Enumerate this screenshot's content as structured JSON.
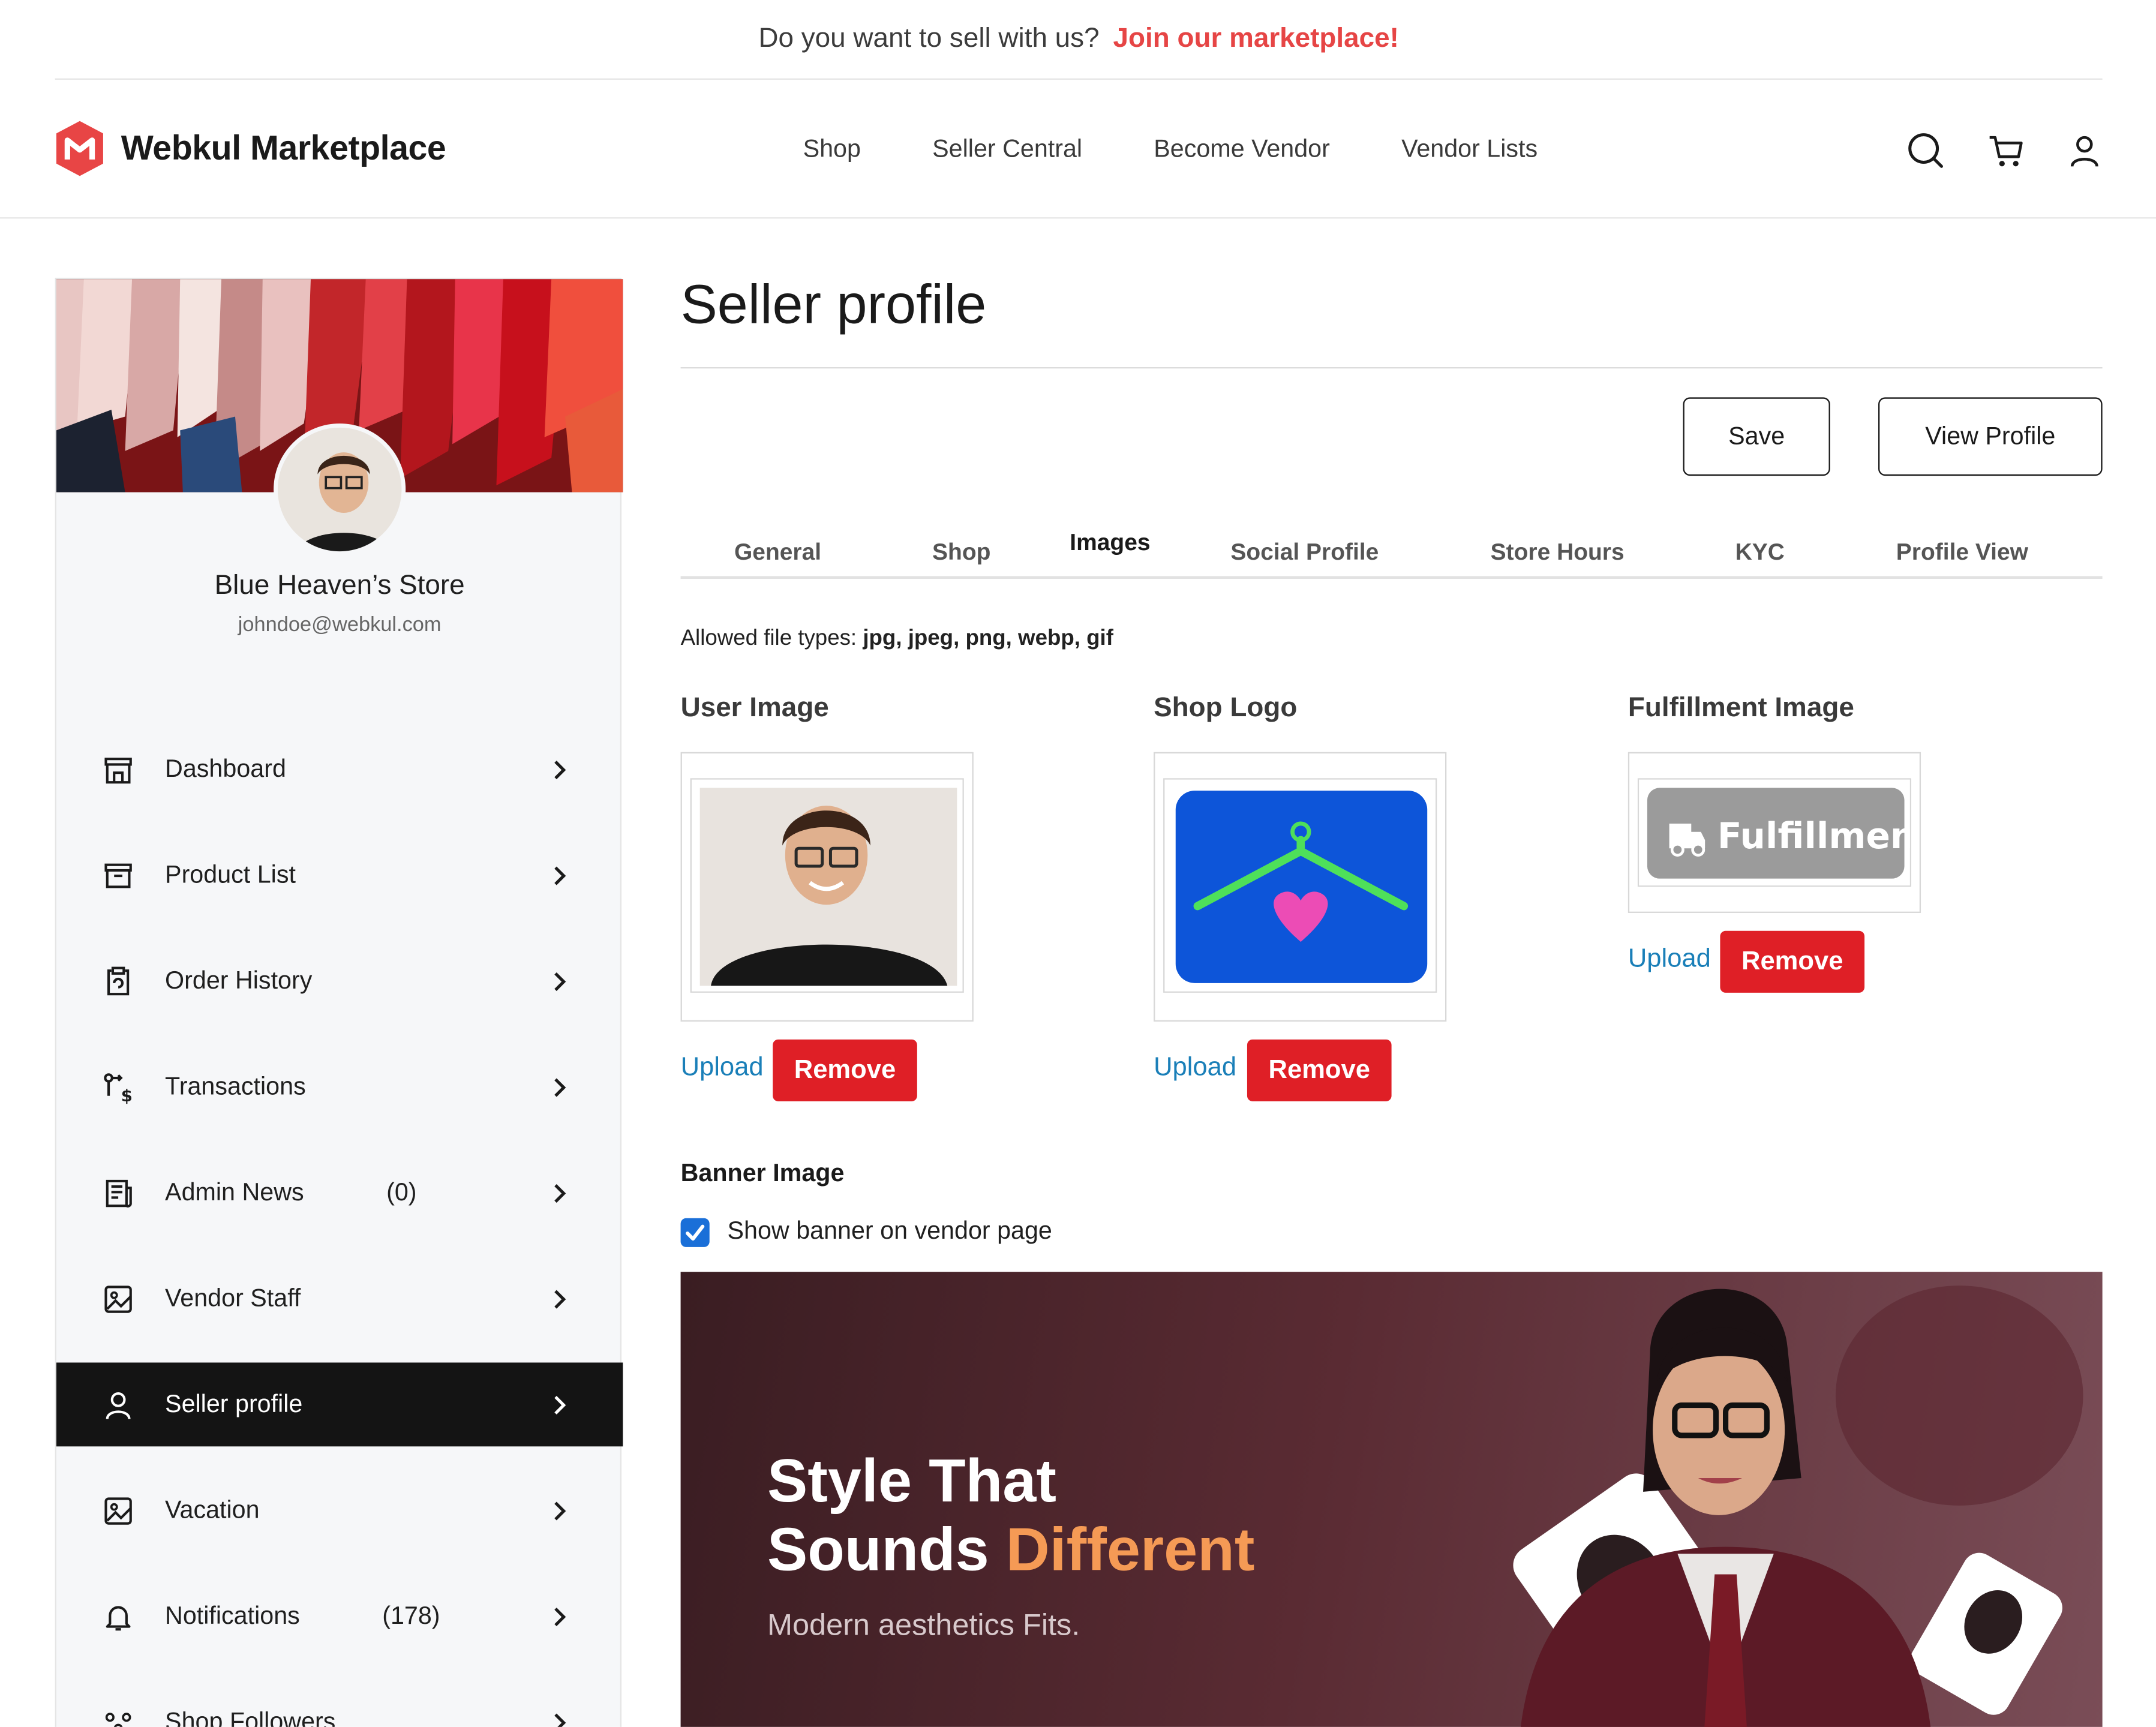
{
  "announcement": {
    "text": "Do you want to sell with us?",
    "cta": "Join our marketplace!"
  },
  "header": {
    "brand": "Webkul Marketplace",
    "nav": [
      "Shop",
      "Seller Central",
      "Become Vendor",
      "Vendor Lists"
    ],
    "icons": [
      "search-icon",
      "cart-icon",
      "user-icon"
    ]
  },
  "sidebar": {
    "store_name": "Blue Heaven’s Store",
    "email": "johndoe@webkul.com",
    "items": [
      {
        "label": "Dashboard",
        "icon": "store-icon",
        "count": ""
      },
      {
        "label": "Product List",
        "icon": "archive-icon",
        "count": ""
      },
      {
        "label": "Order History",
        "icon": "clipboard-icon",
        "count": ""
      },
      {
        "label": "Transactions",
        "icon": "transactions-icon",
        "count": ""
      },
      {
        "label": "Admin News",
        "icon": "news-icon",
        "count": "(0)"
      },
      {
        "label": "Vendor Staff",
        "icon": "image-icon",
        "count": ""
      },
      {
        "label": "Seller profile",
        "icon": "user-icon",
        "count": "",
        "active": true
      },
      {
        "label": "Vacation",
        "icon": "image-icon",
        "count": ""
      },
      {
        "label": "Notifications",
        "icon": "bell-icon",
        "count": "(178)"
      },
      {
        "label": "Shop Followers",
        "icon": "followers-icon",
        "count": ""
      }
    ]
  },
  "page": {
    "title": "Seller profile",
    "save_label": "Save",
    "view_profile_label": "View Profile",
    "tabs": [
      "General",
      "Shop",
      "Images",
      "Social Profile",
      "Store Hours",
      "KYC",
      "Profile View"
    ],
    "active_tab": "Images",
    "allowed_prefix": "Allowed file types:",
    "allowed_types": "jpg, jpeg, png, webp, gif",
    "images": [
      {
        "title": "User Image",
        "upload": "Upload",
        "remove": "Remove"
      },
      {
        "title": "Shop Logo",
        "upload": "Upload",
        "remove": "Remove"
      },
      {
        "title": "Fulfillment Image",
        "upload": "Upload",
        "remove": "Remove",
        "image_text": "Fulfillment"
      }
    ],
    "banner": {
      "title": "Banner Image",
      "checkbox_label": "Show banner on vendor page",
      "checked": true,
      "headline_1": "Style That",
      "headline_2a": "Sounds",
      "headline_2b": "Different",
      "subline": "Modern aesthetics Fits."
    }
  },
  "colors": {
    "accent_red": "#df1f26",
    "link_blue": "#1a7fb8",
    "cta_red": "#e64545",
    "checkbox_blue": "#1a6fd8",
    "active_menu": "#141414"
  }
}
